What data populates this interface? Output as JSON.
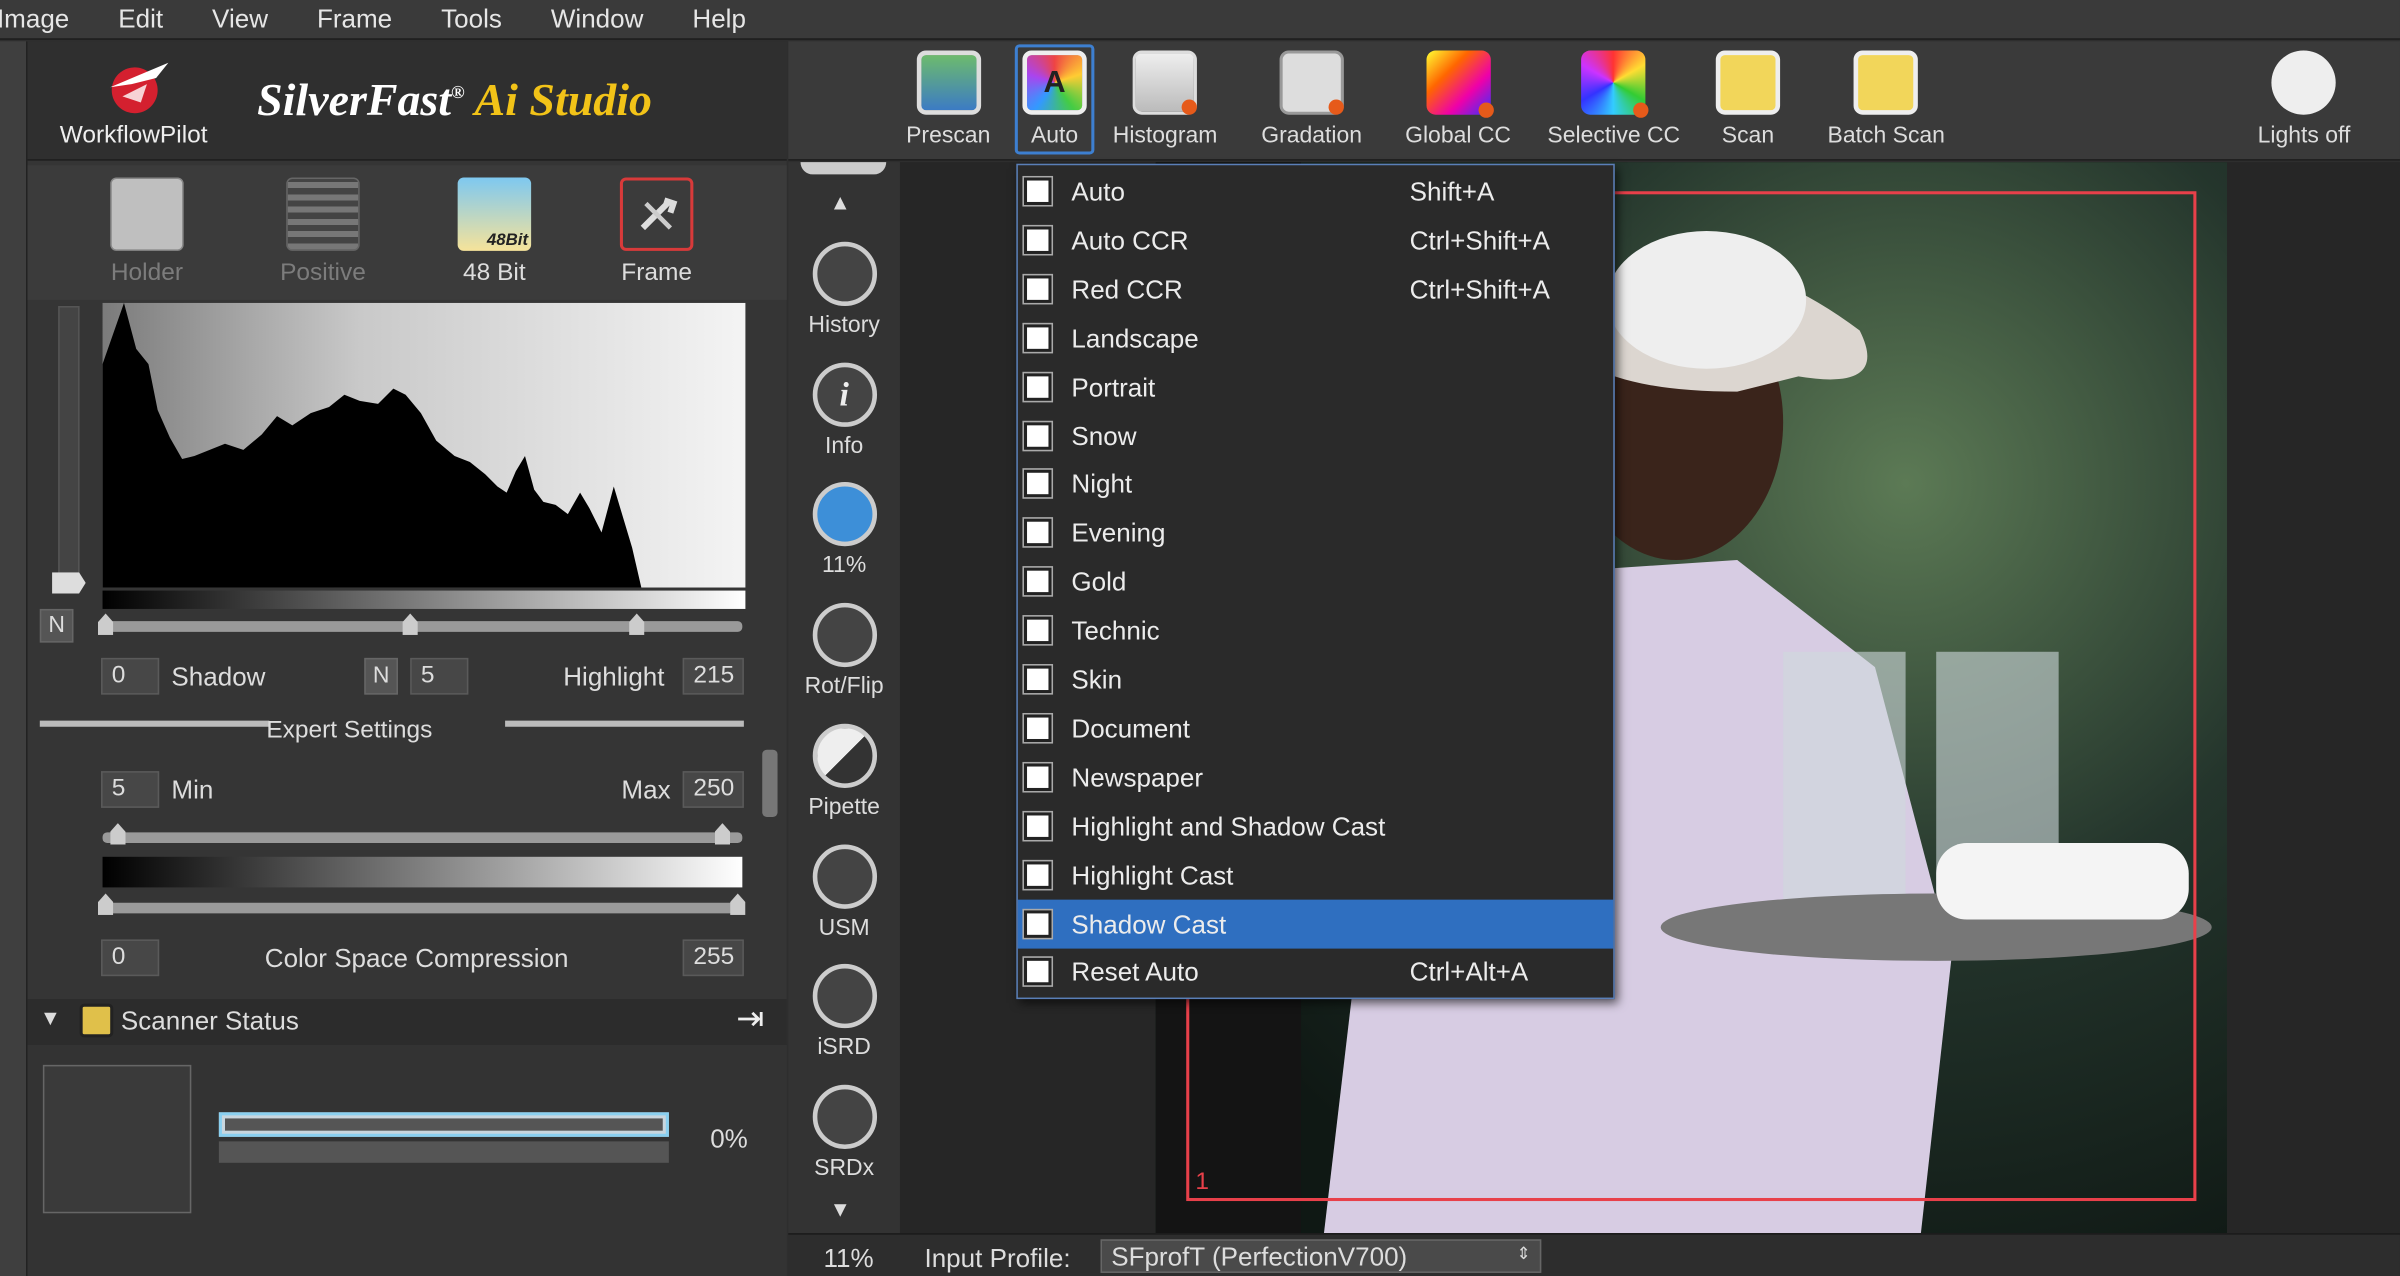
{
  "menubar": [
    "Image",
    "Edit",
    "View",
    "Frame",
    "Tools",
    "Window",
    "Help"
  ],
  "brand": {
    "title_main": "SilverFast",
    "title_reg": "®",
    "title_sub": "Ai Studio",
    "workflow": "WorkflowPilot"
  },
  "modes": [
    {
      "label": "Holder",
      "enabled": false
    },
    {
      "label": "Positive",
      "enabled": false
    },
    {
      "label": "48 Bit",
      "badge": "48Bit",
      "enabled": true
    },
    {
      "label": "Frame",
      "enabled": true
    }
  ],
  "histogram": {
    "n_label": "N",
    "shadow_value": "0",
    "shadow_label": "Shadow",
    "mid_n": "N",
    "mid_value": "5",
    "highlight_label": "Highlight",
    "highlight_value": "215",
    "expert_label": "Expert Settings",
    "min_value": "5",
    "min_label": "Min",
    "max_label": "Max",
    "max_value": "250",
    "csc_low": "0",
    "csc_label": "Color Space Compression",
    "csc_high": "255"
  },
  "scanner": {
    "title": "Scanner Status",
    "progress": 0,
    "progress_text": "0%"
  },
  "toolbar": [
    {
      "label": "Prescan",
      "icon": "prescan-icon"
    },
    {
      "label": "Auto",
      "icon": "auto-icon",
      "active": true
    },
    {
      "label": "Histogram",
      "icon": "histogram-icon"
    },
    {
      "label": "Gradation",
      "icon": "gradation-icon"
    },
    {
      "label": "Global CC",
      "icon": "global-cc-icon"
    },
    {
      "label": "Selective CC",
      "icon": "selective-cc-icon"
    },
    {
      "label": "Scan",
      "icon": "scan-icon"
    },
    {
      "label": "Batch Scan",
      "icon": "batch-scan-icon"
    },
    {
      "label": "Lights off",
      "icon": "lights-off-icon"
    }
  ],
  "sidetools": [
    {
      "label": "History",
      "icon": "history-icon"
    },
    {
      "label": "Info",
      "icon": "info-icon"
    },
    {
      "label": "11%",
      "icon": "zoom-icon"
    },
    {
      "label": "Rot/Flip",
      "icon": "rotate-flip-icon"
    },
    {
      "label": "Pipette",
      "icon": "pipette-icon"
    },
    {
      "label": "USM",
      "icon": "usm-icon"
    },
    {
      "label": "iSRD",
      "icon": "isrd-icon"
    },
    {
      "label": "SRDx",
      "icon": "srdx-icon"
    }
  ],
  "status": {
    "zoom": "11%",
    "profile_label": "Input Profile:",
    "profile_value": "SFprofT (PerfectionV700)"
  },
  "frame_number": "1",
  "dropdown": [
    {
      "label": "Auto",
      "shortcut": "Shift+A"
    },
    {
      "label": "Auto CCR",
      "shortcut": "Ctrl+Shift+A"
    },
    {
      "label": "Red CCR",
      "shortcut": "Ctrl+Shift+A"
    },
    {
      "label": "Landscape",
      "shortcut": ""
    },
    {
      "label": "Portrait",
      "shortcut": ""
    },
    {
      "label": "Snow",
      "shortcut": ""
    },
    {
      "label": "Night",
      "shortcut": ""
    },
    {
      "label": "Evening",
      "shortcut": ""
    },
    {
      "label": "Gold",
      "shortcut": ""
    },
    {
      "label": "Technic",
      "shortcut": ""
    },
    {
      "label": "Skin",
      "shortcut": ""
    },
    {
      "label": "Document",
      "shortcut": ""
    },
    {
      "label": "Newspaper",
      "shortcut": ""
    },
    {
      "label": "Highlight and Shadow Cast",
      "shortcut": ""
    },
    {
      "label": "Highlight Cast",
      "shortcut": ""
    },
    {
      "label": "Shadow Cast",
      "shortcut": "",
      "selected": true
    },
    {
      "label": "Reset Auto",
      "shortcut": "Ctrl+Alt+A"
    }
  ],
  "colors": {
    "accent": "#2f6fc0",
    "frame_red": "#e8404a",
    "brand_yellow": "#f2c318"
  }
}
